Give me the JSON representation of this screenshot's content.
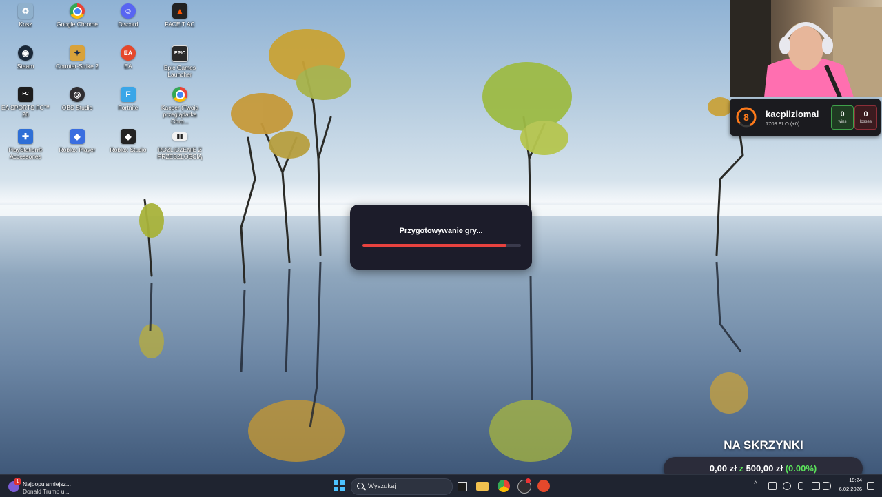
{
  "desktop_icons": [
    {
      "label": "Kosz",
      "icon": "recycle-bin-icon",
      "color": "#8fb0cc"
    },
    {
      "label": "Google Chrome",
      "icon": "chrome-icon",
      "color": "#e9a31a"
    },
    {
      "label": "Discord",
      "icon": "discord-icon",
      "color": "#5865f2"
    },
    {
      "label": "FACEIT AC",
      "icon": "faceit-ac-icon",
      "color": "#222222"
    },
    {
      "label": "Steam",
      "icon": "steam-icon",
      "color": "#1b2838"
    },
    {
      "label": "Counter-Strike 2",
      "icon": "counter-strike-icon",
      "color": "#d9a23a"
    },
    {
      "label": "EA",
      "icon": "ea-icon",
      "color": "#e5482b"
    },
    {
      "label": "Epic Games Launcher",
      "icon": "epic-games-icon",
      "color": "#2a2a2a"
    },
    {
      "label": "EA SPORTS FC™ 26",
      "icon": "ea-sports-fc-icon",
      "color": "#1d1d1d"
    },
    {
      "label": "OBS Studio",
      "icon": "obs-icon",
      "color": "#302e31"
    },
    {
      "label": "Fortnite",
      "icon": "fortnite-icon",
      "color": "#3aa6e8"
    },
    {
      "label": "Kacper (Twoja przeglądarka Chro...",
      "icon": "chrome-profile-icon",
      "color": "#3b8ee8"
    },
    {
      "label": "PlayStation® Accessories",
      "icon": "playstation-icon",
      "color": "#2f6fd6"
    },
    {
      "label": "Roblox Player",
      "icon": "roblox-player-icon",
      "color": "#3a6ee0"
    },
    {
      "label": "Roblox Studio",
      "icon": "roblox-studio-icon",
      "color": "#232323"
    },
    {
      "label": "ROZLICZENIE Z PRZESZŁOŚCIĄ",
      "icon": "video-file-icon",
      "color": "#f2f2f2"
    }
  ],
  "loading": {
    "text": "Przygotowywanie gry...",
    "progress_pct": 91
  },
  "faceit": {
    "level": "8",
    "name": "kacpiiziomal",
    "elo": "1703 ELO (+0)",
    "wins": "0",
    "wins_label": "wins",
    "losses": "0",
    "losses_label": "losses"
  },
  "goal": {
    "title": "NA SKRZYNKI",
    "current": "0,00 zł",
    "sep": "z",
    "target": "500,00 zł",
    "percent": "(0.00%)"
  },
  "taskbar": {
    "news_badge": "1",
    "news_title": "Najpopularniejsz...",
    "news_subtitle": "Donald Trump u...",
    "search_placeholder": "Wyszukaj",
    "clock_time": "19:24",
    "clock_date": "6.02.2026"
  }
}
